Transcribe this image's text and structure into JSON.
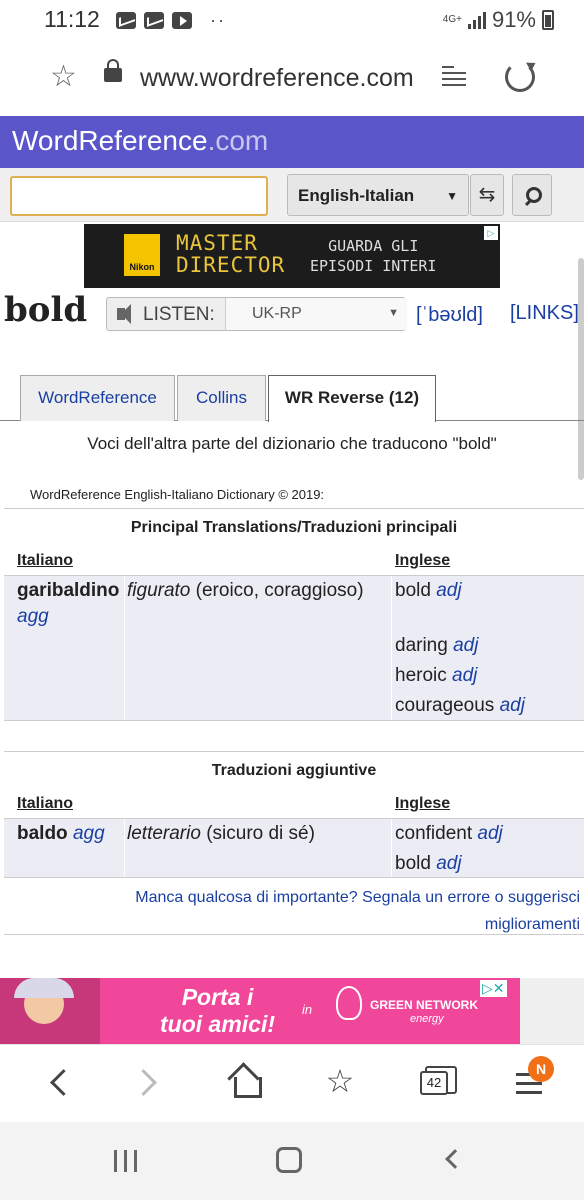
{
  "status_bar": {
    "time": "11:12",
    "network": "4G+",
    "battery": "91%"
  },
  "browser": {
    "url": "www.wordreference.com"
  },
  "site": {
    "logo_main": "WordReference",
    "logo_domain": ".com"
  },
  "search": {
    "value": "",
    "dictionary": "English-Italian"
  },
  "ad_top": {
    "brand": "Nikon",
    "line1": "MASTER",
    "line2": "DIRECTOR",
    "cta1": "GUARDA GLI",
    "cta2": "EPISODI INTERI"
  },
  "word": {
    "headword": "bold",
    "listen_label": "LISTEN:",
    "accent": "UK-RP",
    "ipa": "[ˈbəʊld]",
    "links": "[LINKS]"
  },
  "tabs": [
    {
      "label": "WordReference",
      "active": false
    },
    {
      "label": "Collins",
      "active": false
    },
    {
      "label": "WR Reverse (12)",
      "active": true
    }
  ],
  "intro": "Voci dell'altra parte del dizionario che traducono \"bold\"",
  "copyright": "WordReference English-Italiano Dictionary © 2019:",
  "sections": [
    {
      "title": "Principal Translations/Traduzioni principali",
      "col_source": "Italiano",
      "col_target": "Inglese",
      "entry": {
        "term": "garibaldino",
        "term_pos": "agg",
        "note_label": "figurato",
        "note_text": "(eroico, coraggioso)",
        "translations": [
          {
            "word": "bold",
            "pos": "adj"
          },
          {
            "word": "daring",
            "pos": "adj"
          },
          {
            "word": "heroic",
            "pos": "adj"
          },
          {
            "word": "courageous",
            "pos": "adj"
          }
        ]
      }
    },
    {
      "title": "Traduzioni aggiuntive",
      "col_source": "Italiano",
      "col_target": "Inglese",
      "entry": {
        "term": "baldo",
        "term_pos": "agg",
        "note_label": "letterario",
        "note_text": "(sicuro di sé)",
        "translations": [
          {
            "word": "confident",
            "pos": "adj"
          },
          {
            "word": "bold",
            "pos": "adj"
          }
        ]
      }
    }
  ],
  "report": "Manca qualcosa di importante? Segnala un errore o suggerisci miglioramenti",
  "ad_bottom": {
    "headline1": "Porta i",
    "headline2": "tuoi amici!",
    "in": "in",
    "brand": "GREEN NETWORK",
    "brand_sub": "energy"
  },
  "browser_nav": {
    "tab_count": "42",
    "menu_badge": "N"
  }
}
